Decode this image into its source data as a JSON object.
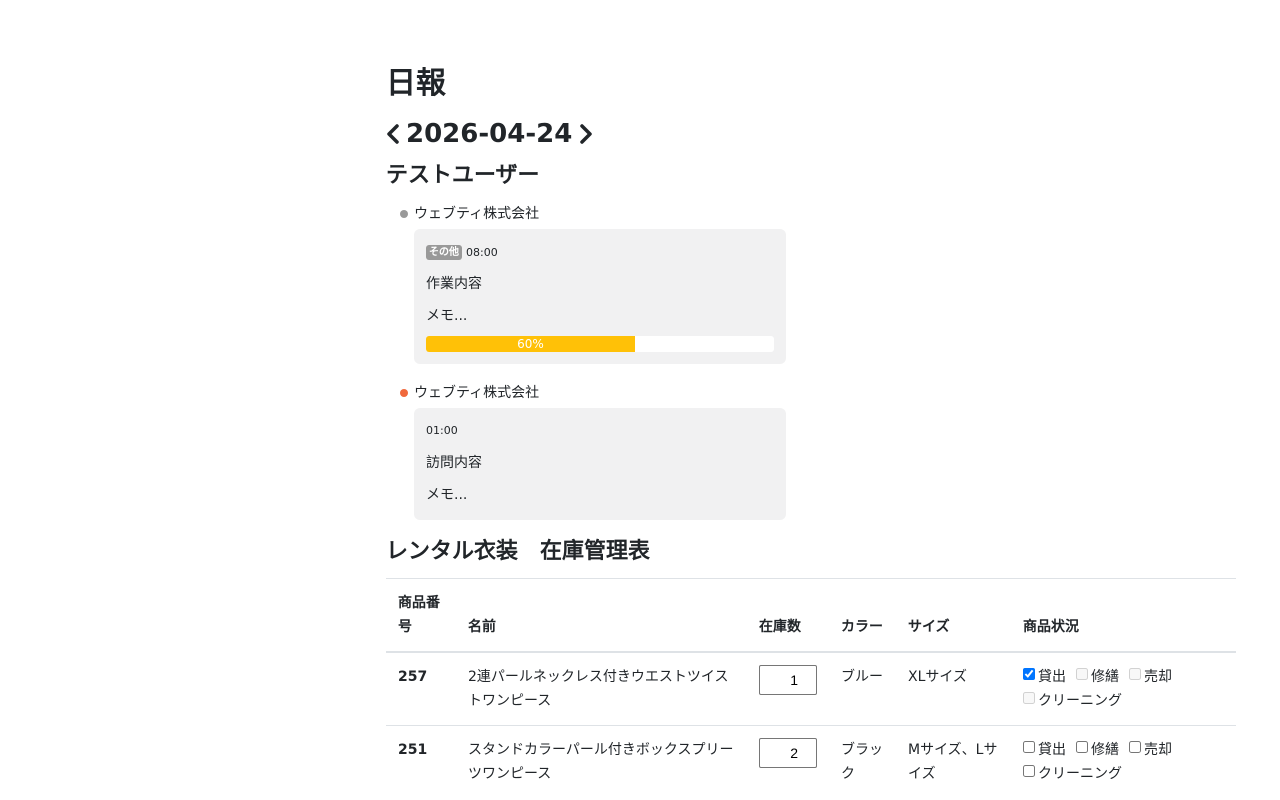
{
  "header": {
    "title": "日報",
    "date": "2026-04-24",
    "user": "テストユーザー"
  },
  "entries": [
    {
      "company": "ウェブティ株式会社",
      "dot_color": "#999999",
      "badge": "その他",
      "time": "08:00",
      "content": "作業内容",
      "memo": "メモ...",
      "progress_percent": 60,
      "progress_label": "60%"
    },
    {
      "company": "ウェブティ株式会社",
      "dot_color": "#f0683c",
      "badge": "",
      "time": "01:00",
      "content": "訪問内容",
      "memo": "メモ..."
    }
  ],
  "inventory": {
    "title": "レンタル衣装　在庫管理表",
    "columns": [
      "商品番号",
      "名前",
      "在庫数",
      "カラー",
      "サイズ",
      "商品状況"
    ],
    "status_labels": [
      "貸出",
      "修繕",
      "売却",
      "クリーニング"
    ],
    "rows": [
      {
        "id": "257",
        "name": "2連パールネックレス付きウエストツイストワンピース",
        "stock": "1",
        "color": "ブルー",
        "size": "XLサイズ",
        "status": [
          true,
          false,
          false,
          false
        ]
      },
      {
        "id": "251",
        "name": "スタンドカラーパール付きボックスプリーツワンピース",
        "stock": "2",
        "color": "ブラック",
        "size": "Mサイズ、Lサイズ",
        "status": [
          false,
          false,
          false,
          false
        ]
      }
    ]
  },
  "colors": {
    "progress": "#ffc107",
    "card_bg": "#f1f1f2",
    "badge_bg": "#999999"
  },
  "icons": {
    "prev": "chevron-left-icon",
    "next": "chevron-right-icon"
  }
}
